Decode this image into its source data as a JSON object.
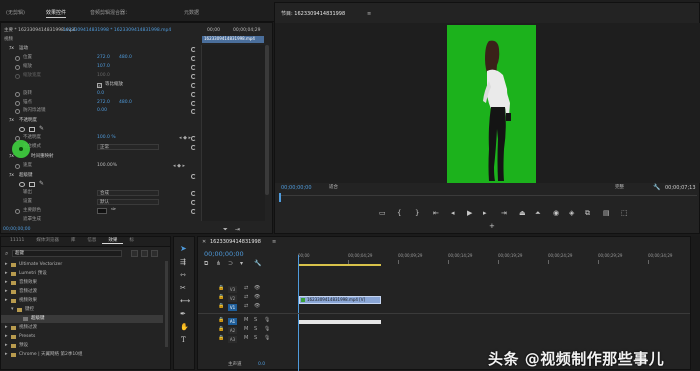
{
  "menu": {
    "title": "(无剪辑)"
  },
  "top_tabs": [
    "效果控件",
    "音频剪辑混合器：",
    "元数据"
  ],
  "effect_controls": {
    "source_path": "主要 * 1623309414831998.mp4",
    "clip_name": "1623309414831998 * 1623309414831998.mp4",
    "clip_timecode": "00;00",
    "clip_end": "00;00;04;29",
    "timeline_clip": "1623309414831998.mp4",
    "section_video": "视频",
    "motion": {
      "label": "运动",
      "position_label": "位置",
      "position_x": "272.0",
      "position_y": "480.0",
      "scale_label": "缩放",
      "scale_value": "107.0",
      "scale_width_label": "缩放宽度",
      "scale_width_value": "100.0",
      "uniform_label": "等比缩放",
      "rotation_label": "旋转",
      "rotation_value": "0.0",
      "anchor_label": "锚点",
      "anchor_x": "272.0",
      "anchor_y": "480.0",
      "flicker_label": "防闪烁滤镜",
      "flicker_value": "0.00"
    },
    "opacity": {
      "label": "不透明度",
      "opacity_label": "不透明度",
      "opacity_value": "100.0 %",
      "blend_label": "混合模式",
      "blend_value": "正常"
    },
    "time_remap": {
      "label": "时间重映射",
      "speed_label": "速度",
      "speed_value": "100.00%"
    },
    "keyer": {
      "label": "超级键",
      "output_label": "输出",
      "output_value": "合成",
      "setting_label": "设置",
      "setting_value": "默认",
      "key_color_label": "主要颜色",
      "mask_label": "遮罩生成"
    },
    "footer_timecode": "00;00;00;00",
    "key_color": "#111111"
  },
  "program": {
    "title": "节目: 1623309414831998",
    "timecode_left": "00;00;00;00",
    "fit_label": "适合",
    "quality_label": "完整",
    "timecode_right": "00;00;07;13",
    "screen_color": "#1cb21c"
  },
  "project": {
    "tabs": [
      "11111",
      "媒体浏览器",
      "库",
      "信息",
      "效果",
      "标"
    ],
    "search_value": "超键",
    "tree": [
      {
        "label": "Ultimate Vectorizer",
        "indent": 0
      },
      {
        "label": "Lumetri 预设",
        "indent": 0
      },
      {
        "label": "音频效果",
        "indent": 0
      },
      {
        "label": "音频过渡",
        "indent": 0
      },
      {
        "label": "视频效果",
        "indent": 0
      },
      {
        "label": "键控",
        "indent": 1
      },
      {
        "label": "超级键",
        "indent": 2,
        "selected": true
      },
      {
        "label": "视频过渡",
        "indent": 0
      },
      {
        "label": "Presets",
        "indent": 0
      },
      {
        "label": "预设",
        "indent": 0
      },
      {
        "label": "Chrome | 天翼网络 第2季10组",
        "indent": 0
      }
    ]
  },
  "timeline": {
    "title": "1623309414831998",
    "timecode": "00;00;00;00",
    "ruler": [
      "00;00",
      "00;00;04;29",
      "00;00;09;29",
      "00;00;14;29",
      "00;00;19;29",
      "00;00;24;29",
      "00;00;29;29",
      "00;00;34;29"
    ],
    "video_tracks": [
      "V3",
      "V2",
      "V1"
    ],
    "audio_tracks": [
      "A1",
      "A2",
      "A3"
    ],
    "master_label": "主声道",
    "master_value": "0.0",
    "clip_label": "1623309414831998.mp4 [V]"
  },
  "watermark": "头条 @视频制作那些事儿"
}
